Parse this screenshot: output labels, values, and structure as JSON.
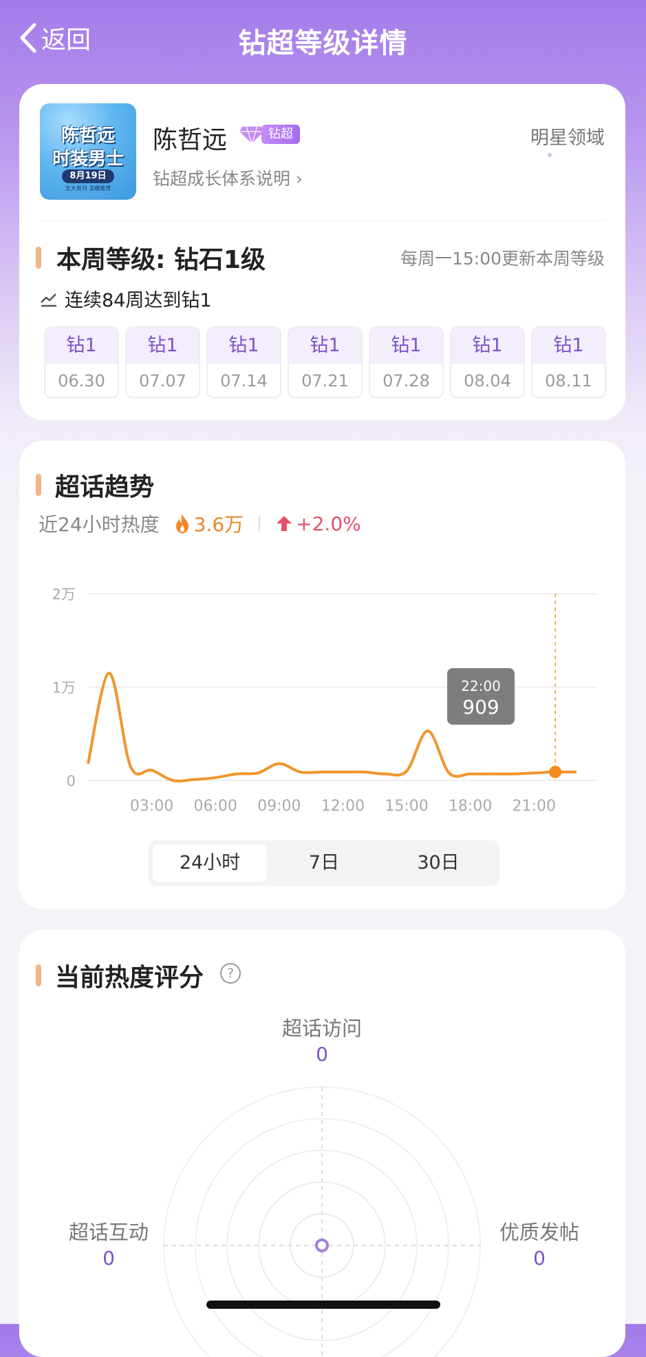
{
  "header": {
    "back_label": "返回",
    "title": "钻超等级详情"
  },
  "profile": {
    "avatar_text": {
      "line1": "陈哲远",
      "line2": "时装男士",
      "line3": "8月19日",
      "line4": "五大男刊 温暖推荐"
    },
    "name": "陈哲远",
    "badge_label": "钻超",
    "growth_link": "钻超成长体系说明",
    "domain": "明星领域"
  },
  "level": {
    "title": "本周等级: 钻石1级",
    "update_note": "每周一15:00更新本周等级",
    "streak": "连续84周达到钻1",
    "weeks": [
      {
        "level": "钻1",
        "date": "06.30"
      },
      {
        "level": "钻1",
        "date": "07.07"
      },
      {
        "level": "钻1",
        "date": "07.14"
      },
      {
        "level": "钻1",
        "date": "07.21"
      },
      {
        "level": "钻1",
        "date": "07.28"
      },
      {
        "level": "钻1",
        "date": "08.04"
      },
      {
        "level": "钻1",
        "date": "08.11"
      }
    ]
  },
  "trend": {
    "title": "超话趋势",
    "heat_label": "近24小时热度",
    "heat_value": "3.6万",
    "change": "+2.0%",
    "tooltip": {
      "time": "22:00",
      "value": "909"
    },
    "ranges": [
      "24小时",
      "7日",
      "30日"
    ],
    "active_range": "24小时",
    "colors": {
      "line": "#f0952c",
      "flame": "#f0892a",
      "up": "#e4526a"
    }
  },
  "chart_data": {
    "type": "line",
    "x_ticks": [
      "03:00",
      "06:00",
      "09:00",
      "12:00",
      "15:00",
      "18:00",
      "21:00"
    ],
    "y_ticks": [
      "0",
      "1万",
      "2万"
    ],
    "ylim": [
      0,
      20000
    ],
    "xlim": [
      0,
      23
    ],
    "series": [
      {
        "x": [
          0,
          1,
          2,
          3,
          4,
          5,
          6,
          7,
          8,
          9,
          10,
          11,
          12,
          13,
          14,
          15,
          16,
          17,
          18,
          19,
          20,
          21,
          22,
          23
        ],
        "y": [
          1800,
          11500,
          1500,
          1100,
          0,
          100,
          300,
          700,
          800,
          1800,
          900,
          900,
          900,
          900,
          700,
          1000,
          5300,
          800,
          700,
          700,
          700,
          800,
          909,
          900
        ]
      }
    ],
    "highlight": {
      "x": 22,
      "y": 909
    }
  },
  "score": {
    "title": "当前热度评分",
    "help_icon": "question-icon",
    "axes": [
      {
        "label": "超话访问",
        "value": "0"
      },
      {
        "label": "超话互动",
        "value": "0"
      },
      {
        "label": "优质发帖",
        "value": "0"
      }
    ]
  }
}
